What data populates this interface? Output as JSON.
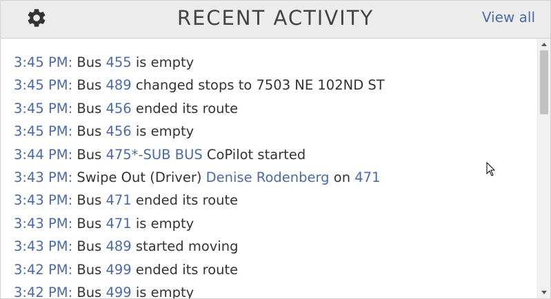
{
  "header": {
    "title": "RECENT ACTIVITY",
    "view_all_label": "View all",
    "settings_icon": "gear-icon"
  },
  "activity": [
    {
      "time": "3:45 PM:",
      "parts": [
        {
          "t": " Bus ",
          "link": false
        },
        {
          "t": "455",
          "link": true
        },
        {
          "t": " is empty",
          "link": false
        }
      ]
    },
    {
      "time": "3:45 PM:",
      "parts": [
        {
          "t": " Bus ",
          "link": false
        },
        {
          "t": "489",
          "link": true
        },
        {
          "t": " changed stops to 7503 NE 102ND ST",
          "link": false
        }
      ]
    },
    {
      "time": "3:45 PM:",
      "parts": [
        {
          "t": " Bus ",
          "link": false
        },
        {
          "t": "456",
          "link": true
        },
        {
          "t": " ended its route",
          "link": false
        }
      ]
    },
    {
      "time": "3:45 PM:",
      "parts": [
        {
          "t": " Bus ",
          "link": false
        },
        {
          "t": "456",
          "link": true
        },
        {
          "t": " is empty",
          "link": false
        }
      ]
    },
    {
      "time": "3:44 PM:",
      "parts": [
        {
          "t": " Bus ",
          "link": false
        },
        {
          "t": "475*-SUB BUS",
          "link": true
        },
        {
          "t": " CoPilot started",
          "link": false
        }
      ]
    },
    {
      "time": "3:43 PM:",
      "parts": [
        {
          "t": " Swipe Out (Driver) ",
          "link": false
        },
        {
          "t": "Denise Rodenberg",
          "link": true
        },
        {
          "t": " on ",
          "link": false
        },
        {
          "t": "471",
          "link": true
        }
      ]
    },
    {
      "time": "3:43 PM:",
      "parts": [
        {
          "t": " Bus ",
          "link": false
        },
        {
          "t": "471",
          "link": true
        },
        {
          "t": " ended its route",
          "link": false
        }
      ]
    },
    {
      "time": "3:43 PM:",
      "parts": [
        {
          "t": " Bus ",
          "link": false
        },
        {
          "t": "471",
          "link": true
        },
        {
          "t": " is empty",
          "link": false
        }
      ]
    },
    {
      "time": "3:43 PM:",
      "parts": [
        {
          "t": " Bus ",
          "link": false
        },
        {
          "t": "489",
          "link": true
        },
        {
          "t": " started moving",
          "link": false
        }
      ]
    },
    {
      "time": "3:42 PM:",
      "parts": [
        {
          "t": " Bus ",
          "link": false
        },
        {
          "t": "499",
          "link": true
        },
        {
          "t": " ended its route",
          "link": false
        }
      ]
    },
    {
      "time": "3:42 PM:",
      "parts": [
        {
          "t": " Bus ",
          "link": false
        },
        {
          "t": "499",
          "link": true
        },
        {
          "t": " is empty",
          "link": false
        }
      ]
    }
  ],
  "colors": {
    "link": "#4a6aa8",
    "text": "#333333",
    "header_bg": "#ececec",
    "title": "#444444"
  }
}
